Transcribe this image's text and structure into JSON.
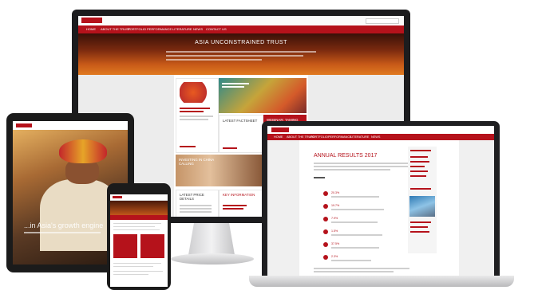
{
  "monitor": {
    "hero_title": "ASIA UNCONSTRAINED TRUST",
    "nav": [
      "HOME",
      "ABOUT THE TRUST",
      "PORTFOLIO",
      "PERFORMANCE",
      "LITERATURE",
      "NEWS",
      "CONTACT US"
    ],
    "tiles": {
      "latest_factsheet": "LATEST FACTSHEET",
      "webinar": "WEBINAR: TAMING THE ASIAN TIGER",
      "investing_china": "INVESTING IN CHINA CALLING",
      "latest_price": "LATEST PRICE DETAILS",
      "key_information": "KEY INFORMATION"
    }
  },
  "tablet": {
    "headline": "...in Asia's growth engine"
  },
  "laptop": {
    "title": "ANNUAL RESULTS 2017",
    "nav": [
      "HOME",
      "ABOUT THE TRUST",
      "PORTFOLIO",
      "PERFORMANCE",
      "LITERATURE",
      "NEWS"
    ],
    "stats": [
      "20.3%",
      "19.7%",
      "7.9%",
      "1.5%",
      "37.5%",
      "2.3%"
    ]
  },
  "colors": {
    "brand_red": "#b5121b",
    "hero_orange": "#c85a18"
  }
}
